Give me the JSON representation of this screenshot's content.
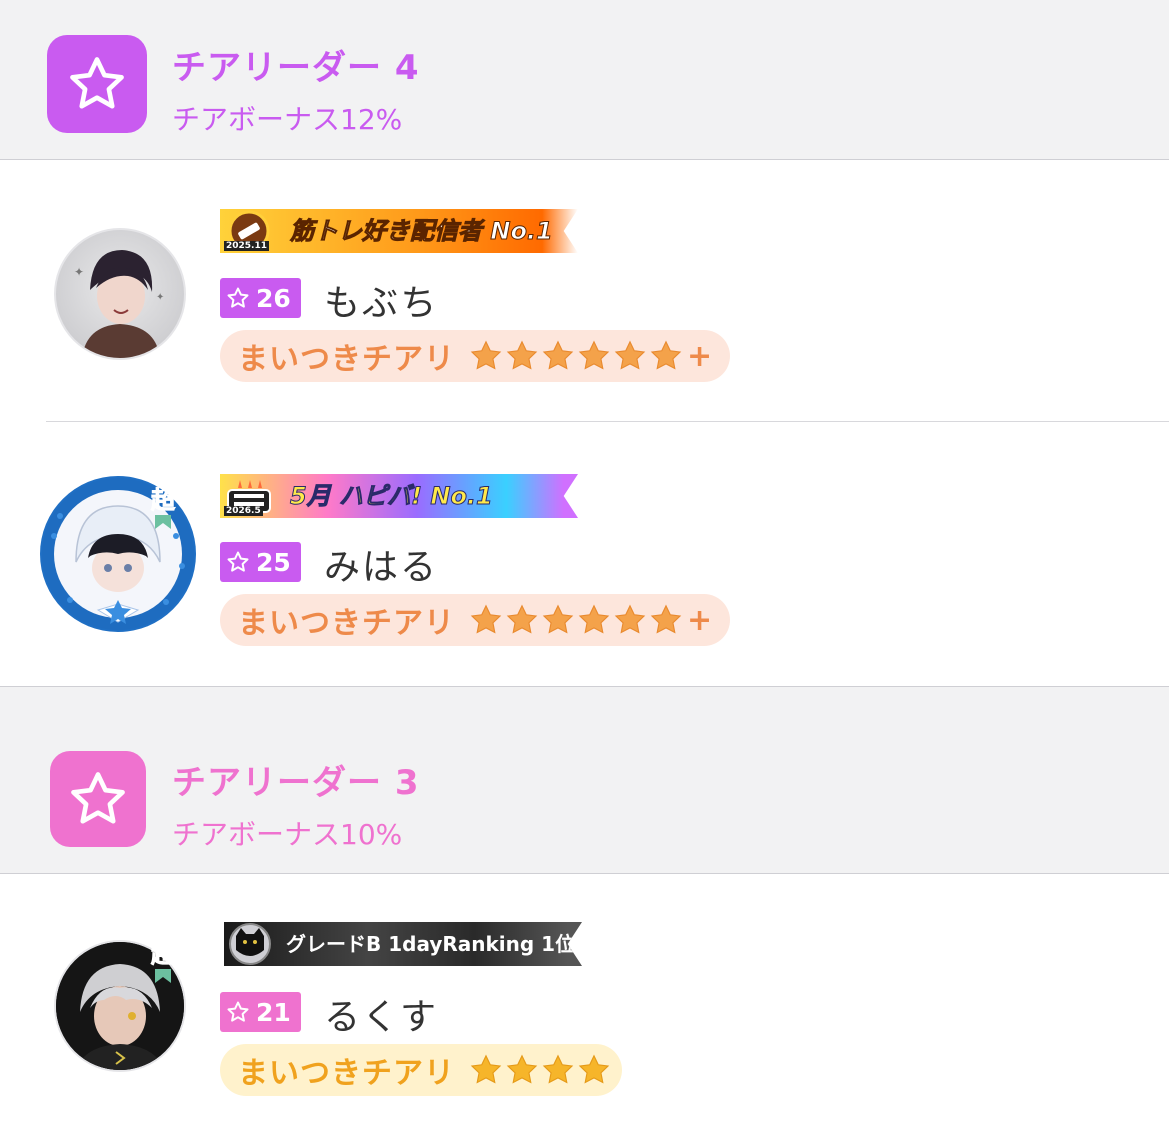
{
  "tiers": [
    {
      "title": "チアリーダー 4",
      "bonus": "チアボーナス12%",
      "color": "#c95bf0",
      "icon": "star-outline-icon",
      "members": [
        {
          "name": "もぶち",
          "level": "26",
          "banner": {
            "text": "筋トレ好き配信者 No.1",
            "year": "2025.11",
            "theme": "fire"
          },
          "cheer_label": "まいつきチアリ",
          "stars": 6,
          "plus": "+",
          "cheer_theme": "orange",
          "super_badge": ""
        },
        {
          "name": "みはる",
          "level": "25",
          "banner": {
            "text": "5月 ハピバ! No.1",
            "year": "2026.5",
            "theme": "rainbow"
          },
          "cheer_label": "まいつきチアリ",
          "stars": 6,
          "plus": "+",
          "cheer_theme": "orange",
          "super_badge": "超"
        }
      ]
    },
    {
      "title": "チアリーダー 3",
      "bonus": "チアボーナス10%",
      "color": "#ef72cf",
      "icon": "star-outline-icon",
      "members": [
        {
          "name": "るくす",
          "level": "21",
          "banner": {
            "text": "グレードB 1dayRanking 1位",
            "year": "",
            "theme": "dark"
          },
          "cheer_label": "まいつきチアリ",
          "stars": 4,
          "plus": "",
          "cheer_theme": "yellow",
          "super_badge": "超"
        }
      ]
    }
  ],
  "colors": {
    "orange_pill_bg": "#fde6dc",
    "orange_pill_text": "#ee8a4a",
    "yellow_pill_bg": "#fff2cc",
    "yellow_pill_text": "#f0a21e",
    "star_fill": "#f4a24a"
  }
}
